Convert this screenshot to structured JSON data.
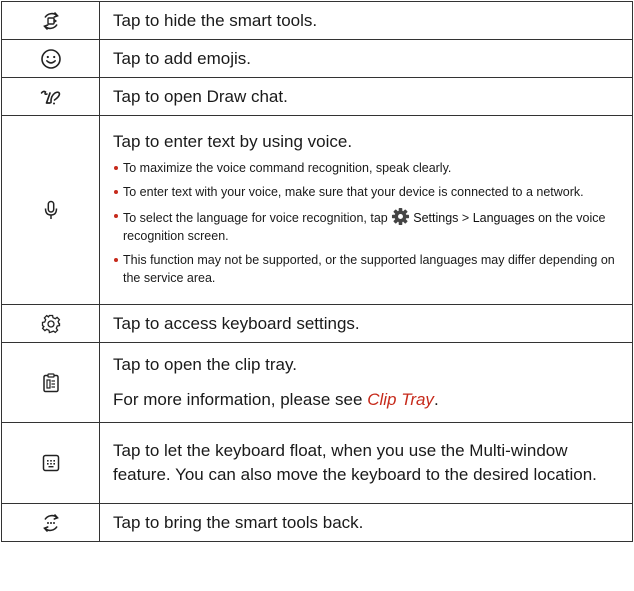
{
  "rows": [
    {
      "icon": "hide-smart-tools-icon",
      "text": "Tap to hide the smart tools."
    },
    {
      "icon": "emoji-icon",
      "text": "Tap to add emojis."
    },
    {
      "icon": "draw-chat-icon",
      "text": "Tap to open Draw chat."
    },
    {
      "icon": "microphone-icon",
      "text": "Tap to enter text by using voice.",
      "bullets": [
        "To maximize the voice command recognition, speak clearly.",
        "To enter text with your voice, make sure that your device is connected to a network.",
        {
          "pre": "To select the language for voice recognition, tap",
          "settings": "Settings",
          "sep": ">",
          "languages": "Languages",
          "post": "on the voice recognition screen."
        },
        "This function may not be supported, or the supported languages may differ depending on the service area."
      ]
    },
    {
      "icon": "settings-gear-icon",
      "text": "Tap to access keyboard settings."
    },
    {
      "icon": "clip-tray-icon",
      "text": "Tap to open the clip tray.",
      "more_pre": "For more information, please see",
      "more_link": "Clip Tray",
      "more_post": "."
    },
    {
      "icon": "floating-keyboard-icon",
      "text": "Tap to let the keyboard float, when you use the Multi-window feature. You can also move the keyboard to the desired location."
    },
    {
      "icon": "show-smart-tools-icon",
      "text": "Tap to bring the smart tools back."
    }
  ],
  "colors": {
    "bullet": "#c62a1b",
    "link": "#c62a1b",
    "border": "#333333",
    "text": "#1a1a1a"
  }
}
